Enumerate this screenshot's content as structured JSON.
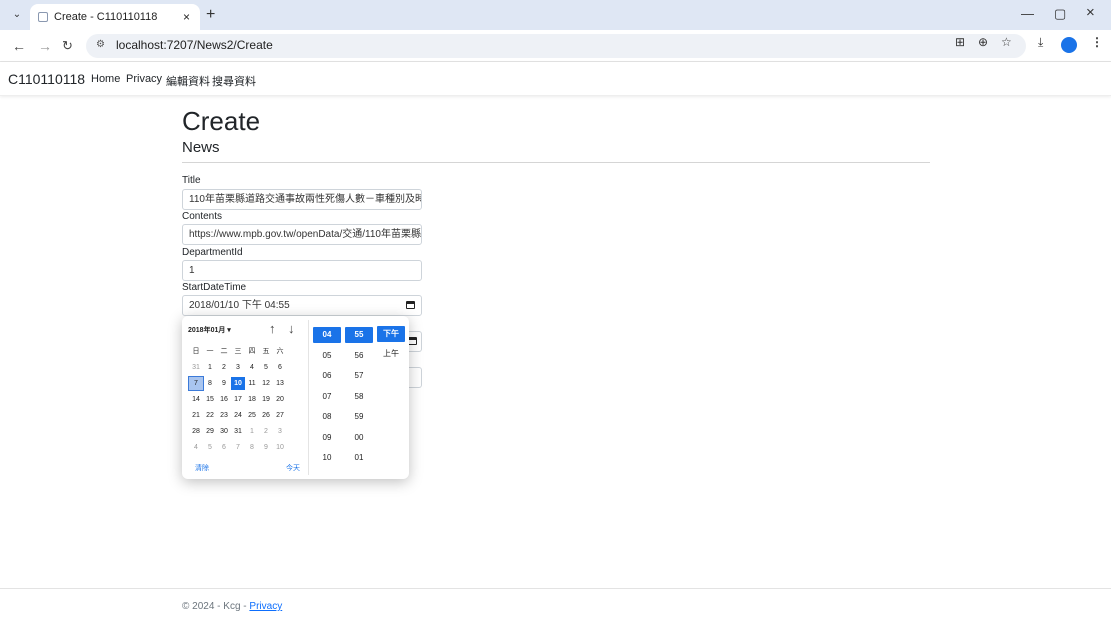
{
  "browser": {
    "tab_title": "Create - C110110118",
    "tab_close": "×",
    "new_tab": "+",
    "url": "localhost:7207/News2/Create",
    "minimize": "—",
    "restore": "▢",
    "close": "×"
  },
  "navbar": {
    "brand": "C110110118",
    "links": [
      "Home",
      "Privacy",
      "編輯資料",
      "搜尋資料"
    ]
  },
  "page": {
    "title": "Create",
    "subtitle": "News"
  },
  "form": {
    "title_label": "Title",
    "title_value": "110年苗栗縣道路交通事故兩性死傷人數－車種別及時序",
    "contents_label": "Contents",
    "contents_value": "https://www.mpb.gov.tw/openData/交通/110年苗栗縣",
    "department_label": "DepartmentId",
    "department_value": "1",
    "start_label": "StartDateTime",
    "start_value": "2018/01/10 下午 04:55"
  },
  "picker": {
    "month_label": "2018年01月 ▾",
    "up_arrow": "↑",
    "down_arrow": "↓",
    "weekdays": [
      "日",
      "一",
      "二",
      "三",
      "四",
      "五",
      "六"
    ],
    "weeks": [
      [
        "31",
        "1",
        "2",
        "3",
        "4",
        "5",
        "6"
      ],
      [
        "7",
        "8",
        "9",
        "10",
        "11",
        "12",
        "13"
      ],
      [
        "14",
        "15",
        "16",
        "17",
        "18",
        "19",
        "20"
      ],
      [
        "21",
        "22",
        "23",
        "24",
        "25",
        "26",
        "27"
      ],
      [
        "28",
        "29",
        "30",
        "31",
        "1",
        "2",
        "3"
      ],
      [
        "4",
        "5",
        "6",
        "7",
        "8",
        "9",
        "10"
      ]
    ],
    "clear_label": "清除",
    "today_label": "今天",
    "hours": [
      "04",
      "05",
      "06",
      "07",
      "08",
      "09",
      "10"
    ],
    "minutes": [
      "55",
      "56",
      "57",
      "58",
      "59",
      "00",
      "01"
    ],
    "ampm": [
      "下午",
      "上午"
    ]
  },
  "footer": {
    "text": "© 2024 - Kcg - ",
    "privacy_link": "Privacy"
  }
}
